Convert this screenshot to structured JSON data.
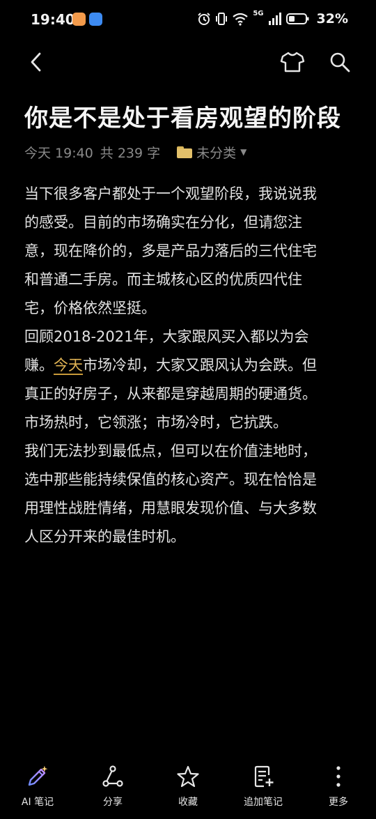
{
  "status_bar": {
    "time": "19:40",
    "network": "5G",
    "battery": "32%"
  },
  "toolbar": {
    "back_icon": "chevron-left-icon",
    "theme_icon": "tshirt-icon",
    "search_icon": "search-icon"
  },
  "note": {
    "title": "你是不是处于看房观望的阶段",
    "date": "今天 19:40",
    "word_count": "共 239 字",
    "folder": "未分类",
    "lines": [
      "当下很多客户都处于一个观望阶段，我说说我",
      "的感受。目前的市场确实在分化，但请您注",
      "意，现在降价的，多是产品力落后的三代住宅",
      "和普通二手房。而主城核心区的优质四代住",
      "宅，价格依然坚挺。",
      "回顾2018-2021年，大家跟风买入都以为会",
      [
        "赚。",
        "今天",
        "市场冷却，大家又跟风认为会跌。但"
      ],
      "真正的好房子，从来都是穿越周期的硬通货。",
      "市场热时，它领涨；市场冷时，它抗跌。",
      "我们无法抄到最低点，但可以在价值洼地时，",
      "选中那些能持续保值的核心资产。现在恰恰是",
      "用理性战胜情绪，用慧眼发现价值、与大多数",
      "人区分开来的最佳时机。"
    ]
  },
  "bottom_nav": {
    "ai_note": "AI 笔记",
    "share": "分享",
    "favorite": "收藏",
    "append_note": "追加笔记",
    "more": "更多"
  },
  "colors": {
    "background": "#000000",
    "highlight": "#e0b354",
    "folder": "#e3c06a",
    "meta_text": "#8a8a8a"
  }
}
